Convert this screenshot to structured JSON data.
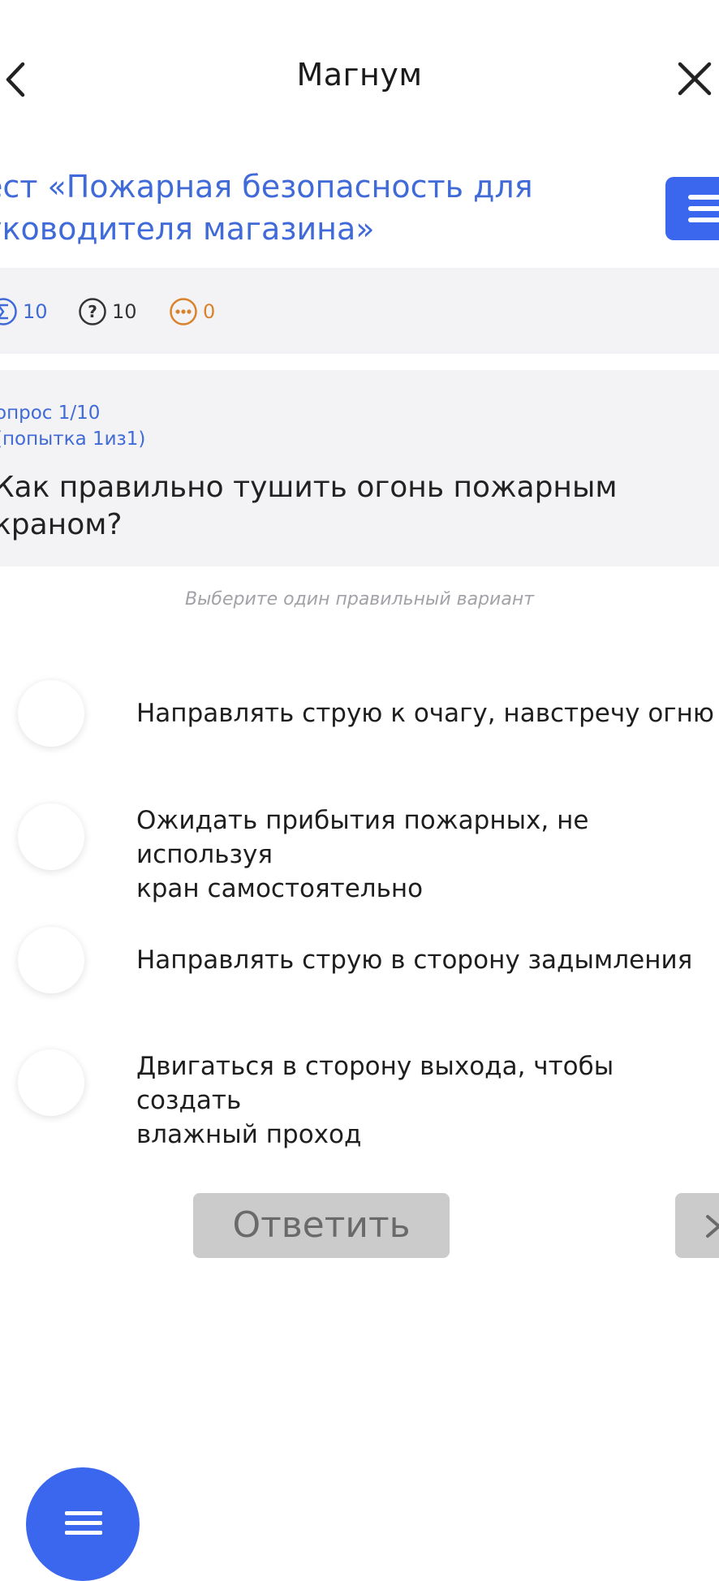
{
  "header": {
    "title": "Магнум",
    "back_icon": "chevron-left-icon",
    "close_icon": "close-icon"
  },
  "test": {
    "title_line1": "ест «Пожарная безопасность для",
    "title_line2": "уководителя магазина»",
    "menu_icon": "menu-icon"
  },
  "stats": {
    "total": "10",
    "questions": "10",
    "pending": "0",
    "colors": {
      "total": "#3f6ad8",
      "questions": "#333333",
      "pending": "#d9822b"
    }
  },
  "question": {
    "number": "опрос 1/10",
    "attempt": "(попытка 1из1)",
    "text_line1": "Как правильно тушить огонь пожарным",
    "text_line2": "краном?"
  },
  "hint": "Выберите один правильный вариант",
  "options": [
    {
      "line1": "Направлять струю к очагу, навстречу огню",
      "line2": ""
    },
    {
      "line1": "Ожидать прибытия пожарных, не используя",
      "line2": "кран самостоятельно"
    },
    {
      "line1": "Направлять струю в сторону задымления",
      "line2": ""
    },
    {
      "line1": "Двигаться в сторону выхода, чтобы создать",
      "line2": "влажный проход"
    }
  ],
  "actions": {
    "answer_label": "Ответить",
    "next_icon": "chevron-right-icon"
  },
  "fab": {
    "icon": "menu-icon"
  },
  "accent_color": "#3b67ee"
}
